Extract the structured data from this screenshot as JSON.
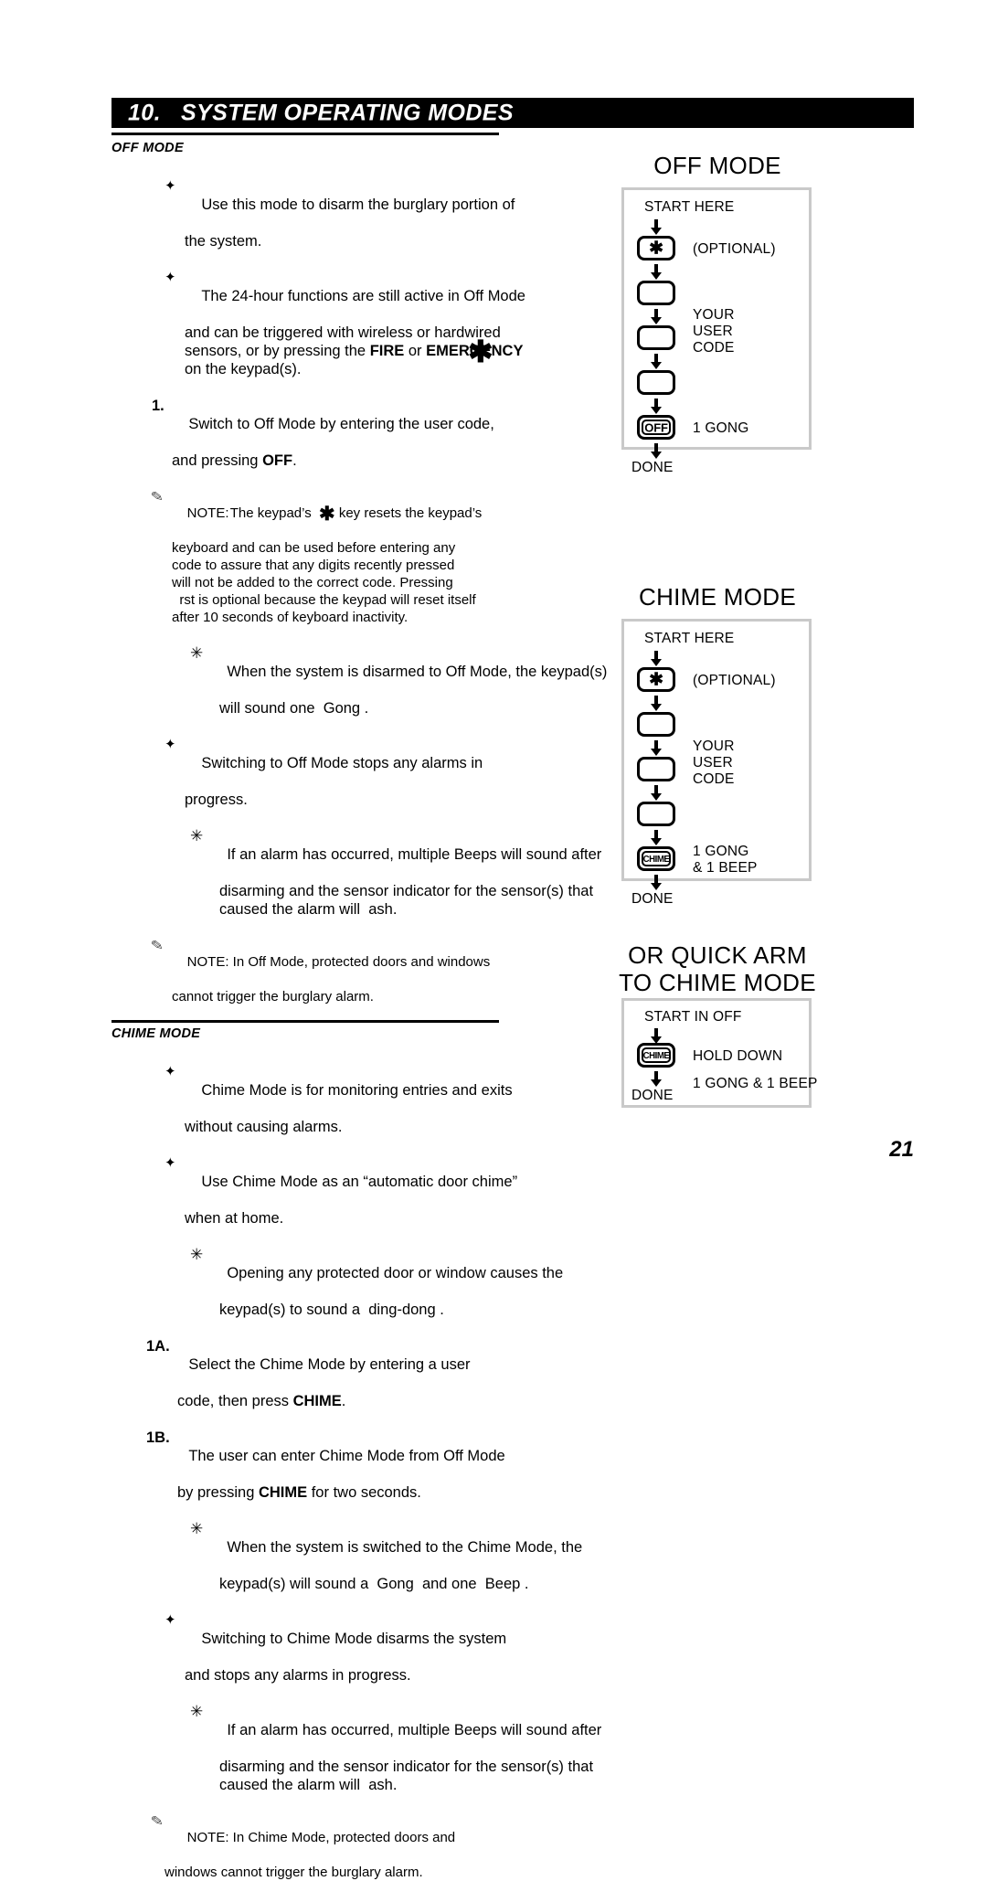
{
  "header": {
    "number": "10.",
    "title": "SYSTEM OPERATING MODES",
    "title_full": "10.   SYSTEM OPERATING MODES"
  },
  "page_number": "21",
  "icons": {
    "diamond_bullet": "✦",
    "star_bullet": "✳",
    "pencil_note": "✎",
    "big_asterisk": "✱",
    "down_arrow": "down-arrow-icon"
  },
  "sections": [
    {
      "id": "off-mode",
      "heading": "OFF MODE",
      "items": [
        {
          "type": "diamond",
          "lines": [
            "Use this mode to disarm the burglary portion of",
            "the system."
          ]
        },
        {
          "type": "diamond",
          "lines": [
            "The 24-hour functions are still active in Off Mode",
            "and can be triggered with wireless or hardwired",
            "sensors, or by pressing the FIRE or EMERGENCY",
            "on the keypad(s)."
          ]
        },
        {
          "type": "number",
          "marker": "1.",
          "lines": [
            "Switch to Off Mode by entering the user code,",
            "and pressing OFF."
          ]
        },
        {
          "type": "note",
          "marker": "NOTE:",
          "lines": [
            "NOTE: The keypad’s  ✱ key resets the keypad’s",
            "keyboard and can be used before entering any",
            "code to assure that any digits recently pressed",
            "will not be added to the correct code. Pressing",
            "  rst is optional because the keypad will reset itself",
            "after 10 seconds of keyboard inactivity."
          ]
        },
        {
          "type": "star",
          "lines": [
            "When the system is disarmed to Off Mode, the keypad(s)",
            "will sound one  Gong ."
          ]
        },
        {
          "type": "diamond",
          "lines": [
            "Switching to Off Mode stops any alarms in",
            "progress."
          ]
        },
        {
          "type": "star",
          "lines": [
            "If an alarm has occurred, multiple Beeps will sound after",
            "disarming and the sensor indicator for the sensor(s) that",
            "caused the alarm will  ash."
          ]
        },
        {
          "type": "note",
          "lines": [
            "NOTE: In Off Mode, protected doors and windows",
            "cannot trigger the burglary alarm."
          ]
        }
      ]
    },
    {
      "id": "chime-mode",
      "heading": "CHIME MODE",
      "items": [
        {
          "type": "diamond",
          "lines": [
            "Chime Mode is for monitoring entries and exits",
            "without causing alarms."
          ]
        },
        {
          "type": "diamond",
          "lines": [
            "Use Chime Mode as an “automatic door chime”",
            "when at home."
          ]
        },
        {
          "type": "star",
          "lines": [
            "Opening any protected door or window causes the",
            "keypad(s) to sound a  ding-dong ."
          ]
        },
        {
          "type": "number",
          "marker": "1A.",
          "lines": [
            "Select the Chime Mode by entering a user",
            "code, then press CHIME."
          ]
        },
        {
          "type": "number",
          "marker": "1B.",
          "lines": [
            "The user can enter Chime Mode from Off Mode",
            "by pressing CHIME for two seconds."
          ]
        },
        {
          "type": "star",
          "lines": [
            "When the system is switched to the Chime Mode, the",
            "keypad(s) will sound a  Gong  and one  Beep ."
          ]
        },
        {
          "type": "diamond",
          "lines": [
            "Switching to Chime Mode disarms the system",
            "and stops any alarms in progress."
          ]
        },
        {
          "type": "star",
          "lines": [
            "If an alarm has occurred, multiple Beeps will sound after",
            "disarming and the sensor indicator for the sensor(s) that",
            "caused the alarm will  ash."
          ]
        },
        {
          "type": "note",
          "lines": [
            "NOTE: In Chime Mode, protected doors and",
            "windows cannot trigger the burglary alarm."
          ]
        }
      ]
    }
  ],
  "diagrams": [
    {
      "id": "off-mode-diagram",
      "title": "OFF MODE",
      "start_label": "START HERE",
      "end_label": "DONE",
      "steps": [
        {
          "key": "✱",
          "key_style": "asterisk",
          "label": "(OPTIONAL)"
        },
        {
          "key": "",
          "key_style": "blank",
          "label": ""
        },
        {
          "key": "",
          "key_style": "blank",
          "label": "YOUR\nUSER\nCODE"
        },
        {
          "key": "",
          "key_style": "blank",
          "label": ""
        },
        {
          "key": "OFF",
          "key_style": "text",
          "label": "1 GONG"
        }
      ],
      "code_label_lines": [
        "YOUR",
        "USER",
        "CODE"
      ]
    },
    {
      "id": "chime-mode-diagram",
      "title": "CHIME MODE",
      "start_label": "START HERE",
      "end_label": "DONE",
      "steps": [
        {
          "key": "✱",
          "key_style": "asterisk",
          "label": "(OPTIONAL)"
        },
        {
          "key": "",
          "key_style": "blank",
          "label": ""
        },
        {
          "key": "",
          "key_style": "blank",
          "label": ""
        },
        {
          "key": "",
          "key_style": "blank",
          "label": ""
        },
        {
          "key": "CHIME",
          "key_style": "text",
          "label": "1 GONG\n& 1 BEEP"
        }
      ],
      "code_label_lines": [
        "YOUR",
        "USER",
        "CODE"
      ],
      "result_lines": [
        "1 GONG",
        "& 1 BEEP"
      ]
    },
    {
      "id": "quick-arm-diagram",
      "title_line1": "OR QUICK ARM",
      "title_line2": "TO CHIME MODE",
      "start_label": "START IN OFF",
      "end_label": "DONE",
      "key_label": "CHIME",
      "hold_label": "HOLD DOWN",
      "result_label": "1 GONG & 1 BEEP"
    }
  ],
  "colors": {
    "header_bg": "#000000",
    "header_text": "#ffffff",
    "box_border": "#c9c9c9",
    "text": "#000000"
  }
}
